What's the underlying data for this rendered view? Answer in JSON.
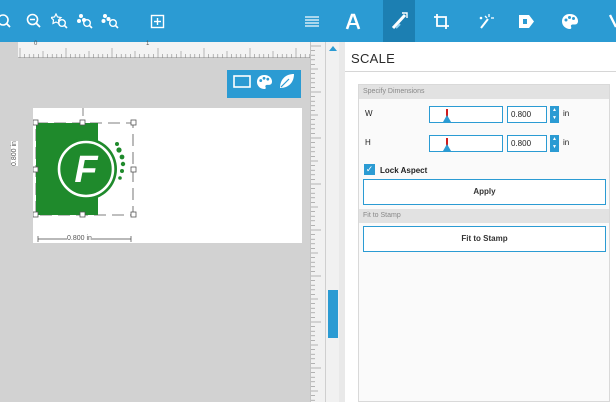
{
  "toolbar": {
    "left_icons": [
      "zoom-in-icon",
      "zoom-out-icon",
      "zoom-fit-icon",
      "zoom-selection-icon",
      "zoom-all-icon",
      "frame-icon"
    ],
    "right_icons": [
      "text-lines-icon",
      "text-icon",
      "transform-icon",
      "crop-icon",
      "magic-wand-icon",
      "stamp-tag-icon",
      "palette-icon"
    ],
    "accent": "#2b9bd3",
    "active_tool": "transform"
  },
  "canvas": {
    "ruler_labels": [
      "0",
      "1"
    ],
    "height_dim": "0.800 in",
    "width_dim": "0.800 in",
    "logo_letter": "F",
    "logo_color": "#1f8a2c"
  },
  "panel": {
    "title": "SCALE",
    "specify_dimensions": "Specify Dimensions",
    "width_label": "W",
    "height_label": "H",
    "width_value": "0.800",
    "height_value": "0.800",
    "unit": "in",
    "lock_aspect_label": "Lock Aspect",
    "lock_aspect_checked": true,
    "apply_label": "Apply",
    "fit_section_label": "Fit to Stamp",
    "fit_button_label": "Fit to Stamp"
  }
}
